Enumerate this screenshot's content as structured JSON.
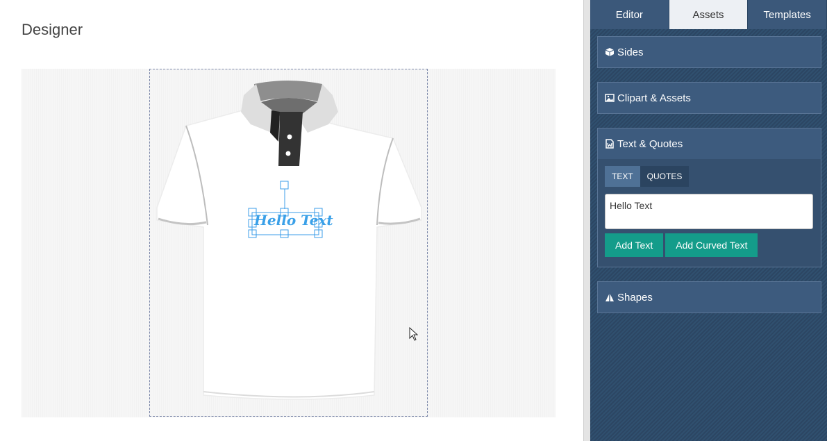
{
  "designer": {
    "title": "Designer",
    "canvas_text": "Hello Text"
  },
  "panel": {
    "tabs": [
      {
        "label": "Editor"
      },
      {
        "label": "Assets"
      },
      {
        "label": "Templates"
      }
    ],
    "active_tab": "Assets",
    "sections": {
      "sides": {
        "label": "Sides",
        "icon": "cube-icon"
      },
      "clipart": {
        "label": "Clipart & Assets",
        "icon": "image-icon"
      },
      "text_quotes": {
        "label": "Text & Quotes",
        "icon": "word-doc-icon",
        "subtabs": [
          {
            "label": "TEXT"
          },
          {
            "label": "QUOTES"
          }
        ],
        "input_value": "Hello Text",
        "add_text_label": "Add Text",
        "add_curved_label": "Add Curved Text"
      },
      "shapes": {
        "label": "Shapes",
        "icon": "shapes-icon"
      }
    }
  },
  "colors": {
    "panel_bg": "#2c4663",
    "accent_button": "#149c8a",
    "selection": "#3b9ce8",
    "text_fill": "#3aa0e8"
  }
}
